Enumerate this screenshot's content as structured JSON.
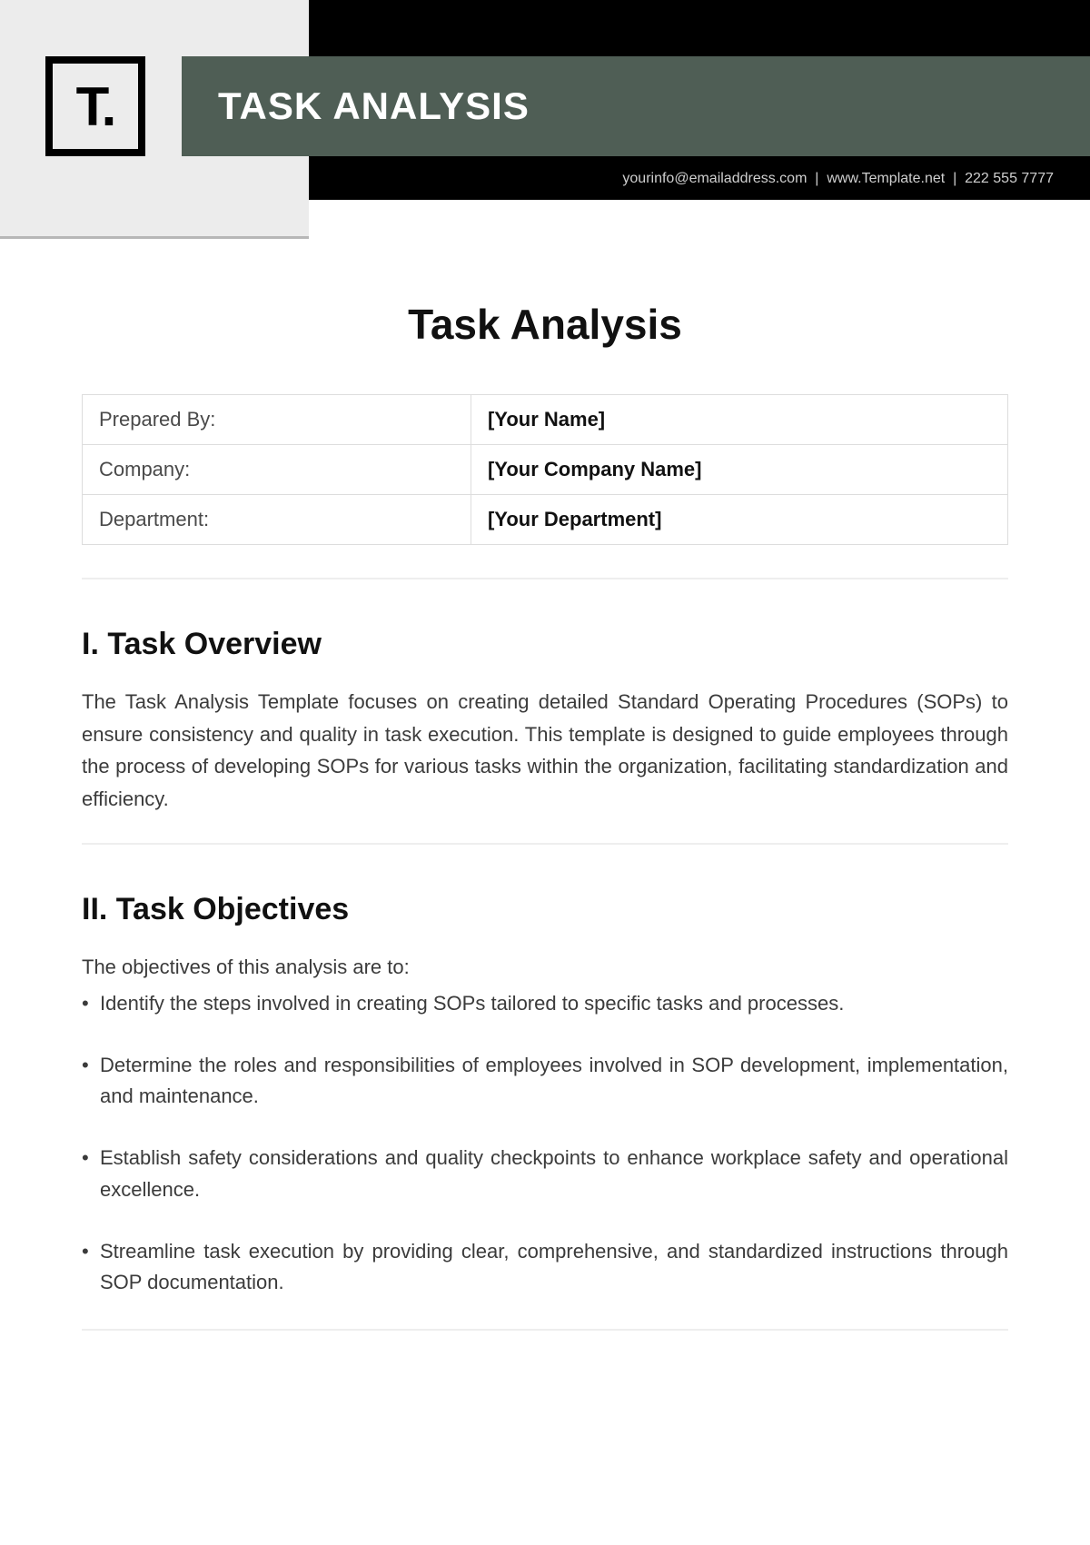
{
  "header": {
    "logo_text": "T.",
    "banner_title": "TASK ANALYSIS",
    "contact_email": "yourinfo@emailaddress.com",
    "contact_site": "www.Template.net",
    "contact_phone": "222 555 7777"
  },
  "document": {
    "title": "Task Analysis",
    "info_table": [
      {
        "label": "Prepared By:",
        "value": "[Your Name]"
      },
      {
        "label": "Company:",
        "value": "[Your Company Name]"
      },
      {
        "label": "Department:",
        "value": "[Your Department]"
      }
    ],
    "sections": {
      "overview": {
        "heading": "I. Task Overview",
        "body": "The Task Analysis Template focuses on creating detailed Standard Operating Procedures (SOPs) to ensure consistency and quality in task execution. This template is designed to guide employees through the process of developing SOPs for various tasks within the organization, facilitating standardization and efficiency."
      },
      "objectives": {
        "heading": "II. Task Objectives",
        "intro": "The objectives of this analysis are to:",
        "items": [
          "Identify the steps involved in creating SOPs tailored to specific tasks and processes.",
          "Determine the roles and responsibilities of employees involved in SOP development, implementation, and maintenance.",
          "Establish safety considerations and quality checkpoints to enhance workplace safety and operational excellence.",
          "Streamline task execution by providing clear, comprehensive, and standardized instructions through SOP documentation."
        ]
      }
    }
  }
}
